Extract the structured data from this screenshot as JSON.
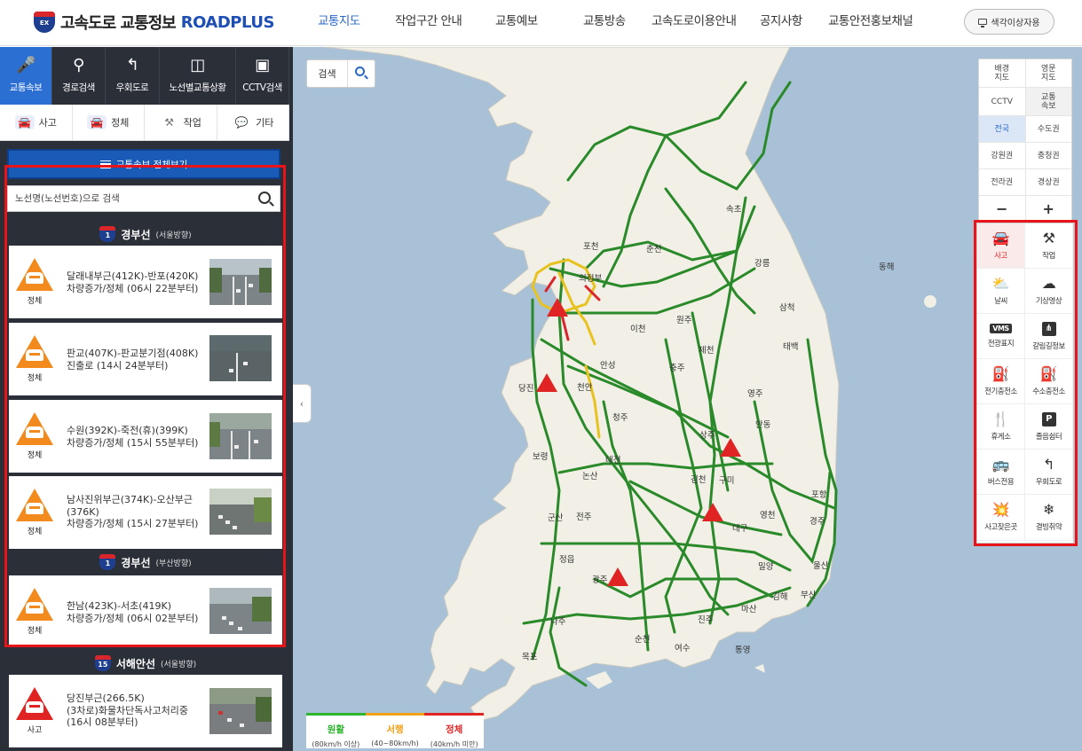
{
  "header": {
    "logo_badge": "EX",
    "logo_title": "고속도로 교통정보",
    "logo_brand": "ROADPLUS",
    "nav": [
      "교통지도",
      "작업구간 안내",
      "교통예보",
      "교통방송",
      "고속도로이용안내",
      "공지사항",
      "교통안전홍보채널"
    ],
    "colorblind_label": "색각이상자용"
  },
  "sidebar": {
    "top_tabs": [
      {
        "label": "교통속보",
        "icon": "microphone-icon"
      },
      {
        "label": "경로검색",
        "icon": "route-search-icon"
      },
      {
        "label": "우회도로",
        "icon": "detour-icon"
      },
      {
        "label": "노선별교통상황",
        "icon": "route-number-icon"
      },
      {
        "label": "CCTV검색",
        "icon": "cctv-icon"
      }
    ],
    "category_tabs": [
      {
        "label": "사고",
        "icon": "accident-car-icon"
      },
      {
        "label": "정체",
        "icon": "congestion-car-icon"
      },
      {
        "label": "작업",
        "icon": "roadwork-icon"
      },
      {
        "label": "기타",
        "icon": "speech-bubble-icon"
      }
    ],
    "view_all_label": "교통속보 전체보기",
    "search_placeholder": "노선명(노선번호)으로 검색",
    "sections": [
      {
        "route_no": "1",
        "route": "경부선",
        "direction": "(서울방향)"
      },
      {
        "route_no": "1",
        "route": "경부선",
        "direction": "(부산방향)"
      },
      {
        "route_no": "15",
        "route": "서해안선",
        "direction": "(서울방향)"
      }
    ],
    "cards": [
      {
        "type": "정체",
        "line1": "달래내부근(412K)-반포(420K)",
        "line2": "차량증가/정체 (06시 22분부터)",
        "line3": ""
      },
      {
        "type": "정체",
        "line1": "판교(407K)-판교분기점(408K)",
        "line2": "진출로 (14시 24분부터)",
        "line3": ""
      },
      {
        "type": "정체",
        "line1": "수원(392K)-죽전(휴)(399K)",
        "line2": "차량증가/정체 (15시 55분부터)",
        "line3": ""
      },
      {
        "type": "정체",
        "line1": "남사진위부근(374K)-오산부근",
        "line2": "(376K)",
        "line3": "차량증가/정체 (15시 27분부터)"
      },
      {
        "type": "정체",
        "line1": "한남(423K)-서초(419K)",
        "line2": "차량증가/정체 (06시 02분부터)",
        "line3": ""
      },
      {
        "type": "사고",
        "line1": "당진부근(266.5K)",
        "line2": "(3차로)화물차단독사고처리중",
        "line3": "(16시 08분부터)"
      }
    ]
  },
  "map": {
    "search_label": "검색",
    "map_types": [
      "배경\n지도",
      "영문\n지도",
      "CCTV",
      "교통\n속보"
    ],
    "regions": [
      "전국",
      "수도권",
      "강원권",
      "충청권",
      "전라권",
      "경상권"
    ],
    "zoom_out": "−",
    "zoom_in": "+",
    "layers": [
      {
        "label": "사고",
        "icon": "accident-icon"
      },
      {
        "label": "작업",
        "icon": "roadwork-icon"
      },
      {
        "label": "날씨",
        "icon": "weather-icon"
      },
      {
        "label": "기상영상",
        "icon": "weather-video-icon"
      },
      {
        "label": "전광표지",
        "icon": "vms-icon"
      },
      {
        "label": "갈림길정보",
        "icon": "junction-icon"
      },
      {
        "label": "전기충전소",
        "icon": "ev-charger-icon"
      },
      {
        "label": "수소충전소",
        "icon": "hydrogen-station-icon"
      },
      {
        "label": "휴게소",
        "icon": "rest-area-icon"
      },
      {
        "label": "졸음쉼터",
        "icon": "parking-icon"
      },
      {
        "label": "버스전용",
        "icon": "bus-lane-icon"
      },
      {
        "label": "우회도로",
        "icon": "detour-icon"
      },
      {
        "label": "사고잦은곳",
        "icon": "accident-prone-icon"
      },
      {
        "label": "결빙취약",
        "icon": "icy-road-icon"
      }
    ],
    "places": [
      "속초",
      "포천",
      "춘천",
      "강릉",
      "의정부",
      "삼척",
      "동해",
      "이천",
      "원주",
      "태백",
      "제천",
      "충주",
      "당진",
      "천안",
      "안성",
      "영주",
      "청주",
      "안동",
      "보령",
      "상주",
      "대전",
      "김천",
      "구미",
      "포항",
      "논산",
      "영천",
      "군산",
      "전주",
      "대구",
      "경주",
      "정읍",
      "울산",
      "밀양",
      "김해",
      "부산",
      "나주",
      "목포",
      "광주",
      "순천",
      "여수",
      "통영",
      "진주",
      "마산"
    ],
    "legend": [
      {
        "label": "원활",
        "range": "(80km/h 이상)",
        "color": "#2db52d"
      },
      {
        "label": "서행",
        "range": "(40~80km/h)",
        "color": "#f0a21a"
      },
      {
        "label": "정체",
        "range": "(40km/h 미만)",
        "color": "#e02323"
      }
    ]
  }
}
